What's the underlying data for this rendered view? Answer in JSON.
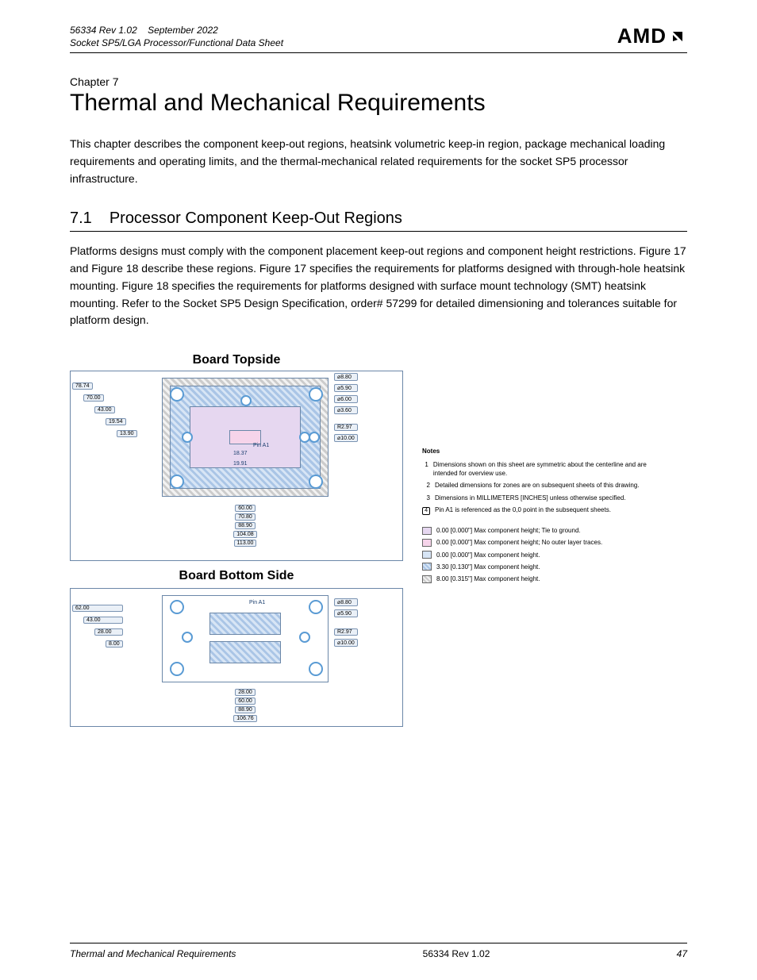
{
  "header": {
    "doc_id": "56334",
    "rev": "Rev 1.02",
    "date": "September 2022",
    "doc_title": "Socket SP5/LGA Processor/Functional Data Sheet"
  },
  "logo_text": "AMD",
  "chapter": {
    "label": "Chapter 7",
    "title": "Thermal and Mechanical Requirements"
  },
  "intro": "This chapter describes the component keep-out regions, heatsink volumetric keep-in region, package mechanical loading requirements and operating limits, and the thermal-mechanical related requirements for the socket SP5 processor infrastructure.",
  "section": {
    "num": "7.1",
    "title": "Processor Component Keep-Out Regions",
    "text": "Platforms designs must comply with the component placement keep-out regions and component height restrictions. Figure 17 and Figure 18 describe these regions. Figure 17 specifies the requirements for platforms designed with through-hole heatsink mounting. Figure 18 specifies the requirements for platforms designed with surface mount technology (SMT) heatsink mounting. Refer to the Socket SP5 Design Specification, order# 57299 for detailed dimensioning and tolerances suitable for platform design."
  },
  "drawing": {
    "top_title": "Board Topside",
    "bottom_title": "Board Bottom Side",
    "pin_label": "Pin A1",
    "top_left_dims": [
      "78.74",
      "70.00",
      "43.00",
      "19.54",
      "13.90"
    ],
    "top_center_dims": [
      "18.37",
      "19.91"
    ],
    "top_bottom_dims": [
      "60.00",
      "70.80",
      "88.90",
      "104.08",
      "113.00"
    ],
    "top_right_callouts": [
      "⌀8.80",
      "⌀5.90",
      "⌀6.00",
      "⌀3.60",
      "R2.97",
      "⌀10.00"
    ],
    "bot_left_dims": [
      "62.00",
      "43.00",
      "28.00",
      "8.00"
    ],
    "bot_bottom_dims": [
      "28.00",
      "60.00",
      "88.90",
      "106.76"
    ],
    "bot_right_callouts": [
      "⌀8.80",
      "⌀5.90",
      "R2.97",
      "⌀10.00"
    ]
  },
  "notes": {
    "heading": "Notes",
    "items": [
      "Dimensions shown on this sheet are symmetric about the centerline and are intended for overview use.",
      "Detailed dimensions for zones are on subsequent sheets of this drawing.",
      "Dimensions in MILLIMETERS [INCHES] unless otherwise specified.",
      "Pin A1 is referenced as the 0,0 point in the subsequent sheets."
    ],
    "flag_index": 4
  },
  "legend": [
    "0.00 [0.000\"] Max component height; Tie to ground.",
    "0.00 [0.000\"] Max component height; No outer layer traces.",
    "0.00 [0.000\"] Max component height.",
    "3.30 [0.130\"] Max component height.",
    "8.00 [0.315\"] Max component height."
  ],
  "footer": {
    "left": "Thermal and Mechanical Requirements",
    "mid": "56334 Rev 1.02",
    "right": "47"
  }
}
